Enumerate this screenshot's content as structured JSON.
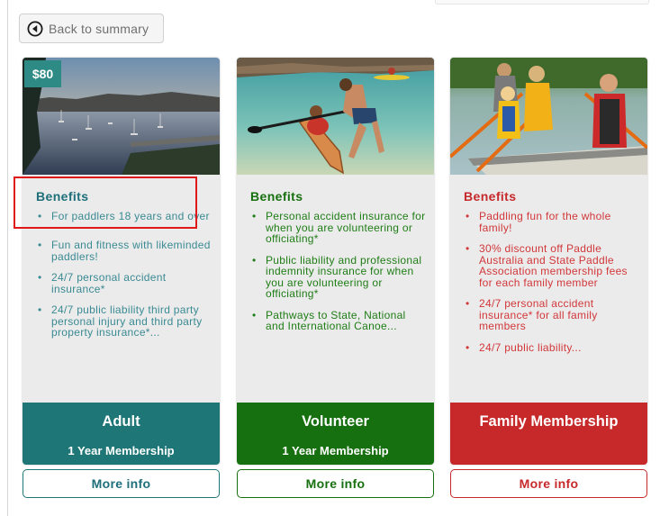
{
  "back_button": {
    "label": "Back to summary",
    "icon": "circle-arrow-left-icon"
  },
  "cards": [
    {
      "price": "$80",
      "benefits_title": "Benefits",
      "benefits": [
        "For paddlers 18 years and over",
        "Fun and fitness with likeminded paddlers!",
        "24/7 personal accident insurance*",
        "24/7 public liability third party personal injury and third party property insurance*..."
      ],
      "title": "Adult",
      "subtitle": "1 Year Membership",
      "more_info": "More info",
      "color": "#1e7676"
    },
    {
      "benefits_title": "Benefits",
      "benefits": [
        "Personal accident insurance for when you are volunteering or officiating*",
        "Public liability and professional indemnity insurance for when you are volunteering or officiating*",
        "Pathways to State, National and International Canoe..."
      ],
      "title": "Volunteer",
      "subtitle": "1 Year Membership",
      "more_info": "More info",
      "color": "#17700f"
    },
    {
      "benefits_title": "Benefits",
      "benefits": [
        "Paddling fun for the whole family!",
        "30% discount off Paddle Australia and State Paddle Association membership fees for each family member",
        "24/7 personal accident insurance* for all family members",
        "24/7 public liability..."
      ],
      "title": "Family Membership",
      "more_info": "More info",
      "color": "#c7282a"
    }
  ]
}
